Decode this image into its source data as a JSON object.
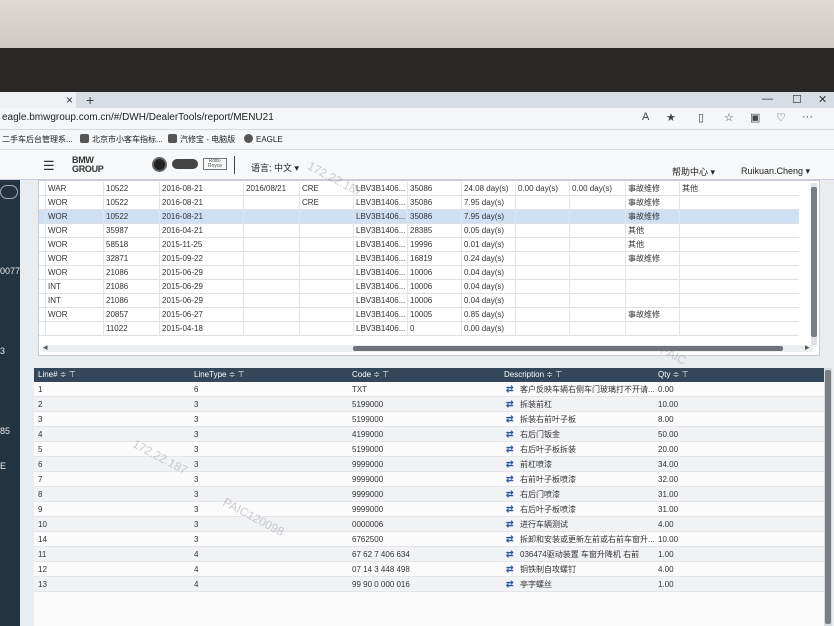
{
  "browser": {
    "tab_close": "×",
    "tab_new": "+",
    "url": "eagle.bmwgroup.com.cn/#/DWH/DealerTools/report/MENU21",
    "bookmarks": [
      {
        "label": "二手车后台管理系..."
      },
      {
        "label": "北京市小客车指标..."
      },
      {
        "label": "汽修宝 - 电脑版"
      },
      {
        "label": "EAGLE"
      }
    ]
  },
  "header": {
    "brand_line1": "BMW",
    "brand_line2": "GROUP",
    "rr_text": "Rolls-Royce",
    "language": "语言: 中文 ▾",
    "help": "帮助中心 ▾",
    "user": "Ruikuan.Cheng ▾"
  },
  "left_strip": [
    "0077",
    "3",
    "85",
    "E"
  ],
  "upper_table": {
    "rows": [
      [
        "WAR",
        "10522",
        "2016-08-21",
        "2016/08/21",
        "CRE",
        "LBV3B1406...",
        "35086",
        "24.08 day(s)",
        "0.00 day(s)",
        "0.00 day(s)",
        "事故维修",
        "其他"
      ],
      [
        "WOR",
        "10522",
        "2016-08-21",
        "",
        "CRE",
        "LBV3B1406...",
        "35086",
        "7.95 day(s)",
        "",
        "",
        "事故维修",
        ""
      ],
      [
        "WOR",
        "10522",
        "2016-08-21",
        "",
        "",
        "LBV3B1406...",
        "35086",
        "7.95 day(s)",
        "",
        "",
        "事故维修",
        ""
      ],
      [
        "WOR",
        "35987",
        "2016-04-21",
        "",
        "",
        "LBV3B1406...",
        "28385",
        "0.05 day(s)",
        "",
        "",
        "其他",
        ""
      ],
      [
        "WOR",
        "58518",
        "2015-11-25",
        "",
        "",
        "LBV3B1406...",
        "19996",
        "0.01 day(s)",
        "",
        "",
        "其他",
        ""
      ],
      [
        "WOR",
        "32871",
        "2015-09-22",
        "",
        "",
        "LBV3B1406...",
        "16819",
        "0.24 day(s)",
        "",
        "",
        "事故维修",
        ""
      ],
      [
        "WOR",
        "21086",
        "2015-06-29",
        "",
        "",
        "LBV3B1406...",
        "10006",
        "0.04 day(s)",
        "",
        "",
        "",
        ""
      ],
      [
        "INT",
        "21086",
        "2015-06-29",
        "",
        "",
        "LBV3B1406...",
        "10006",
        "0.04 day(s)",
        "",
        "",
        "",
        ""
      ],
      [
        "INT",
        "21086",
        "2015-06-29",
        "",
        "",
        "LBV3B1406...",
        "10006",
        "0.04 day(s)",
        "",
        "",
        "",
        ""
      ],
      [
        "WOR",
        "20857",
        "2015-06-27",
        "",
        "",
        "LBV3B1406...",
        "10005",
        "0.85 day(s)",
        "",
        "",
        "事故维修",
        ""
      ],
      [
        "",
        "11022",
        "2015-04-18",
        "",
        "",
        "LBV3B1406...",
        "0",
        "0.00 day(s)",
        "",
        "",
        "",
        ""
      ]
    ],
    "selected_row": 2
  },
  "lower_table": {
    "headers": [
      "Line# ≑ ⊤",
      "LineType ≑ ⊤",
      "Code ≑ ⊤",
      "Description ≑ ⊤",
      "Qty ≑ ⊤"
    ],
    "rows": [
      [
        "1",
        "6",
        "TXT",
        "客户反映车辆右侧车门玻璃打不开请...",
        "0.00"
      ],
      [
        "2",
        "3",
        "5199000",
        "拆装前杠",
        "10.00"
      ],
      [
        "3",
        "3",
        "5199000",
        "拆装右前叶子板",
        "8.00"
      ],
      [
        "4",
        "3",
        "4199000",
        "右后门钣金",
        "50.00"
      ],
      [
        "5",
        "3",
        "5199000",
        "右后叶子板拆装",
        "20.00"
      ],
      [
        "6",
        "3",
        "9999000",
        "前杠喷漆",
        "34.00"
      ],
      [
        "7",
        "3",
        "9999000",
        "右前叶子板喷漆",
        "32.00"
      ],
      [
        "8",
        "3",
        "9999000",
        "右后门喷漆",
        "31.00"
      ],
      [
        "9",
        "3",
        "9999000",
        "右后叶子板喷漆",
        "31.00"
      ],
      [
        "10",
        "3",
        "0000006",
        "进行车辆测试",
        "4.00"
      ],
      [
        "14",
        "3",
        "6762500",
        "拆卸和安装或更新左前或右前车窗升...",
        "10.00"
      ],
      [
        "11",
        "4",
        "67 62 7 406 634",
        "036474驱动装置 车窗升降机 右前",
        "1.00"
      ],
      [
        "12",
        "4",
        "07 14 3 448 498",
        "铜铁制自攻螺钉",
        "4.00"
      ],
      [
        "13",
        "4",
        "99 90 0 000 016",
        "亭字螺丝",
        "1.00"
      ]
    ]
  },
  "watermark": [
    "172.22.187",
    "PAIC",
    "172.22.187",
    "PAIC120098"
  ]
}
